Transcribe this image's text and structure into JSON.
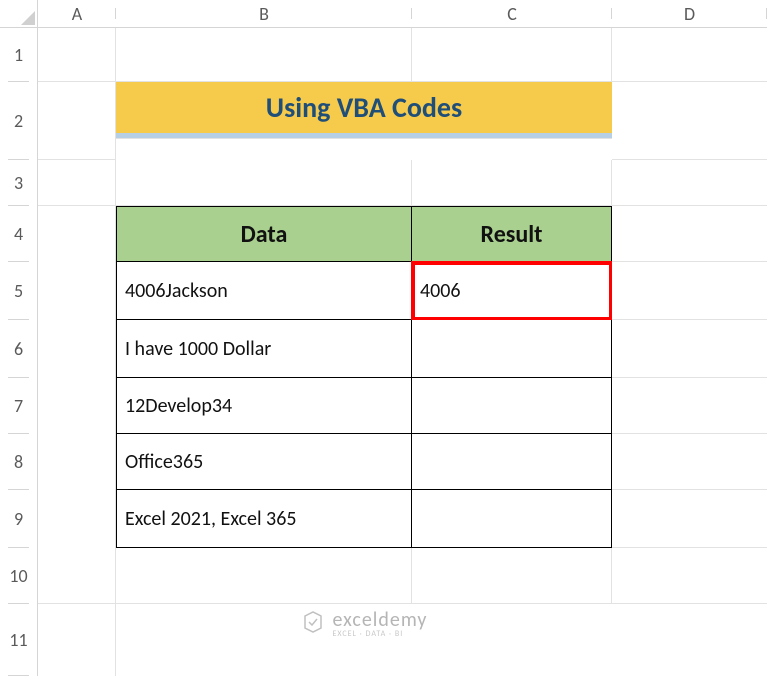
{
  "columns": [
    "A",
    "B",
    "C",
    "D"
  ],
  "rows": [
    "1",
    "2",
    "3",
    "4",
    "5",
    "6",
    "7",
    "8",
    "9",
    "10",
    "11"
  ],
  "title": "Using VBA Codes",
  "table": {
    "headers": [
      "Data",
      "Result"
    ],
    "rows": [
      {
        "data": "4006Jackson",
        "result": "4006"
      },
      {
        "data": "I have 1000 Dollar",
        "result": ""
      },
      {
        "data": "12Develop34",
        "result": ""
      },
      {
        "data": "Office365",
        "result": ""
      },
      {
        "data": "Excel 2021, Excel 365",
        "result": ""
      }
    ]
  },
  "watermark": {
    "main": "exceldemy",
    "sub": "EXCEL · DATA · BI"
  }
}
